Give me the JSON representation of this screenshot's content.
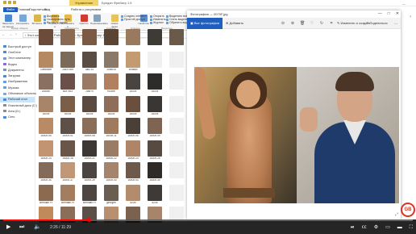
{
  "explorer": {
    "tab_label": "Управление",
    "window_title": "Бредан Фрейзер 1.6",
    "menu": [
      "Файл",
      "Главная",
      "Поделиться",
      "Вид",
      "Работа с рисунками"
    ],
    "ribbon": {
      "buttons": [
        {
          "label": "Закрепить на панели",
          "icon": "pin-icon",
          "color": "#4a88d0"
        },
        {
          "label": "Копировать",
          "icon": "copy-icon",
          "color": "#7aa7d9"
        },
        {
          "label": "Вставить",
          "icon": "paste-icon",
          "color": "#d9b44a"
        },
        {
          "label": "Переместить в",
          "icon": "move-icon",
          "color": "#e5b94c"
        },
        {
          "label": "Копировать в",
          "icon": "copy-to-icon",
          "color": "#e5b94c"
        },
        {
          "label": "Удалить",
          "icon": "delete-icon",
          "color": "#d23b2f"
        },
        {
          "label": "Переименовать",
          "icon": "rename-icon",
          "color": "#8aa0b8"
        },
        {
          "label": "Новая папка",
          "icon": "new-folder-icon",
          "color": "#e7c35a"
        },
        {
          "label": "Свойства",
          "icon": "properties-icon",
          "color": "#5d8fd0"
        }
      ],
      "small": [
        "Вырезать",
        "Скопировать путь",
        "Вставить ярлык",
        "Создать элемент",
        "Простой доступ",
        "Открыть",
        "Изменить",
        "Журнал",
        "Выделить все",
        "Снять выделение",
        "Обратить выделение"
      ],
      "groups": [
        "Буфер обмена",
        "Упорядочить",
        "Создать",
        "Открыть",
        "Выделить"
      ]
    },
    "address": "› Этот компьютер › Рабочий стол › Бредан Фрейзер 1.6",
    "sidebar": [
      {
        "label": "Быстрый доступ",
        "color": "#4a88d0"
      },
      {
        "label": "OneDrive",
        "color": "#4a88d0"
      },
      {
        "label": "Этот компьютер",
        "color": "#5fa0e0"
      },
      {
        "label": "Видео",
        "color": "#8a6bd0"
      },
      {
        "label": "Документы",
        "color": "#6a95c8"
      },
      {
        "label": "Загрузки",
        "color": "#4a88d0"
      },
      {
        "label": "Изображения",
        "color": "#5fa0e0"
      },
      {
        "label": "Музыка",
        "color": "#5fa0e0"
      },
      {
        "label": "Объемные объекты",
        "color": "#6ab0e0"
      },
      {
        "label": "Рабочий стол",
        "color": "#4a88d0"
      },
      {
        "label": "Локальный диск (C:)",
        "color": "#8a8a8a"
      },
      {
        "label": "Area (D:)",
        "color": "#8a8a8a"
      },
      {
        "label": "Сеть",
        "color": "#4a88d0"
      }
    ],
    "files": [
      {
        "name": "",
        "color": "#6b4b3a"
      },
      {
        "name": "",
        "color": "#8a6a52"
      },
      {
        "name": "",
        "color": "#7a5a44"
      },
      {
        "name": "",
        "color": "#5a4434"
      },
      {
        "name": "",
        "color": "#9a7a5e"
      },
      {
        "name": "",
        "color": "#3e3a36"
      },
      {
        "name": "",
        "color": "#6a5a4a"
      },
      {
        "name": "10e8x5bb",
        "color": "#b58a63"
      },
      {
        "name": "2a1b7d5f",
        "color": "#7a6a5a"
      },
      {
        "name": "3ad71c",
        "color": "#5a4e44"
      },
      {
        "name": "2ca9f1d",
        "color": "#8a7868"
      },
      {
        "name": "1e4fd8c",
        "color": "#c49a70"
      },
      {
        "name": "",
        "color": "#f0f0f0"
      },
      {
        "name": "",
        "color": "#f0f0f0"
      },
      {
        "name": "206x50",
        "color": "#8a7060"
      },
      {
        "name": "a1e7c93",
        "color": "#6a5048"
      },
      {
        "name": "2d5f70",
        "color": "#9a7a64"
      },
      {
        "name": "f01bce",
        "color": "#b08060"
      },
      {
        "name": "1600x",
        "color": "#4a4440"
      },
      {
        "name": "1600x",
        "color": "#2e2c2a"
      },
      {
        "name": "",
        "color": "#f0f0f0"
      },
      {
        "name": "1600x",
        "color": "#a88468"
      },
      {
        "name": "1600x",
        "color": "#7a5e48"
      },
      {
        "name": "1600x",
        "color": "#5a4a40"
      },
      {
        "name": "1600x",
        "color": "#8e6e58"
      },
      {
        "name": "1600x",
        "color": "#6a4e3e"
      },
      {
        "name": "1600x",
        "color": "#3a3634"
      },
      {
        "name": "",
        "color": "#f0f0f0"
      },
      {
        "name": "1600x-05",
        "color": "#b88a66"
      },
      {
        "name": "1600x-01",
        "color": "#5e5048"
      },
      {
        "name": "1600x-08",
        "color": "#8a6e5a"
      },
      {
        "name": "1600x-11",
        "color": "#a07a5c"
      },
      {
        "name": "1600x-06",
        "color": "#4a4038"
      },
      {
        "name": "1600x-09",
        "color": "#7e6452"
      },
      {
        "name": "",
        "color": "#f0f0f0"
      },
      {
        "name": "1600x-14",
        "color": "#c29472"
      },
      {
        "name": "1600x-18",
        "color": "#6a5648"
      },
      {
        "name": "1600x-21",
        "color": "#3e3834"
      },
      {
        "name": "1600x-22",
        "color": "#9a7c64"
      },
      {
        "name": "1600x-24",
        "color": "#b08466"
      },
      {
        "name": "1600x-26",
        "color": "#574a40"
      },
      {
        "name": "",
        "color": "#f0f0f0"
      },
      {
        "name": "1600x-35",
        "color": "#846a58"
      },
      {
        "name": "1600x-37",
        "color": "#c09878"
      },
      {
        "name": "1600x-39",
        "color": "#4c4440"
      },
      {
        "name": "1600x-40",
        "color": "#a4846a"
      },
      {
        "name": "1600x-43",
        "color": "#6e5a4c"
      },
      {
        "name": "1600x-45",
        "color": "#2e2a28"
      },
      {
        "name": "",
        "color": "#f0f0f0"
      },
      {
        "name": "Brendan Fr",
        "color": "#8a6a50"
      },
      {
        "name": "Brendan Fr",
        "color": "#a47c5e"
      },
      {
        "name": "Brendan Fr",
        "color": "#4e4642"
      },
      {
        "name": "georgeb",
        "color": "#6a5e52"
      },
      {
        "name": "8206",
        "color": "#b48c6c"
      },
      {
        "name": "8206",
        "color": "#3e3a38"
      },
      {
        "name": "",
        "color": "#f0f0f0"
      },
      {
        "name": "",
        "color": "#c08a5a"
      },
      {
        "name": "",
        "color": "#8a6e58"
      },
      {
        "name": "",
        "color": "#5a5048"
      },
      {
        "name": "",
        "color": "#b89070"
      },
      {
        "name": "",
        "color": "#7a624e"
      },
      {
        "name": "",
        "color": "#a8846a"
      },
      {
        "name": "",
        "color": "#f0f0f0"
      }
    ]
  },
  "photos": {
    "title": "Фотографии — 0070F.jpg",
    "all_photos": "Все фотографии",
    "add": "Добавить",
    "edit_create": "Изменить и создать",
    "share": "Поделиться",
    "window_controls": [
      "—",
      "□",
      "✕"
    ],
    "tool_icons": [
      "zoom-out-icon",
      "zoom-in-icon",
      "delete-icon",
      "favorite-icon",
      "rotate-icon",
      "crop-icon",
      "enhance-icon"
    ]
  },
  "player": {
    "time": "2:26 / 11:29",
    "progress": 0.21,
    "logo": "GB"
  }
}
